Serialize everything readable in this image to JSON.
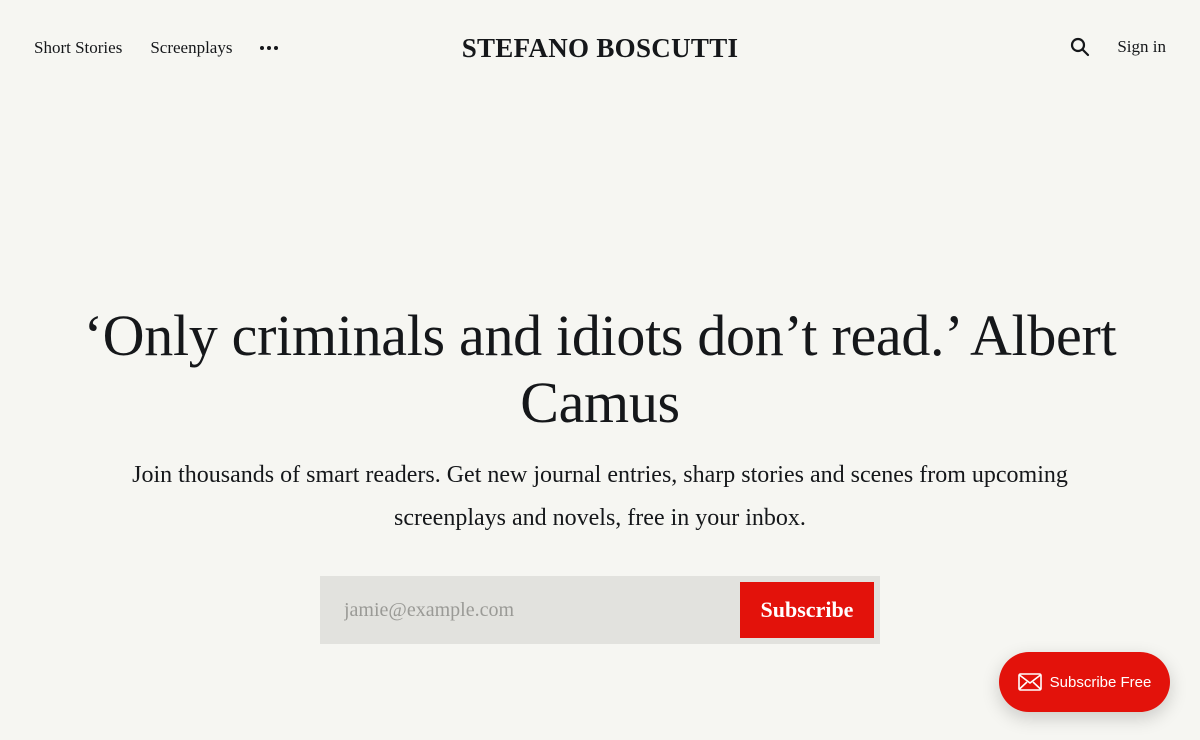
{
  "nav": {
    "left_links": [
      "Short Stories",
      "Screenplays"
    ],
    "more_icon": "more-dots-icon",
    "site_title": "STEFANO BOSCUTTI",
    "search_icon": "search-icon",
    "sign_in": "Sign in"
  },
  "hero": {
    "headline": "‘Only criminals and idiots don’t read.’ Albert Camus",
    "subtext": "Join thousands of smart readers. Get new journal entries, sharp stories and scenes from upcoming screenplays and novels, free in your inbox."
  },
  "signup": {
    "email_placeholder": "jamie@example.com",
    "email_value": "",
    "submit_label": "Subscribe"
  },
  "portal": {
    "icon": "envelope-icon",
    "label": "Subscribe Free"
  },
  "colors": {
    "background": "#f6f6f2",
    "text": "#15171a",
    "accent": "#e3120b",
    "input_bg": "#e2e2de"
  }
}
